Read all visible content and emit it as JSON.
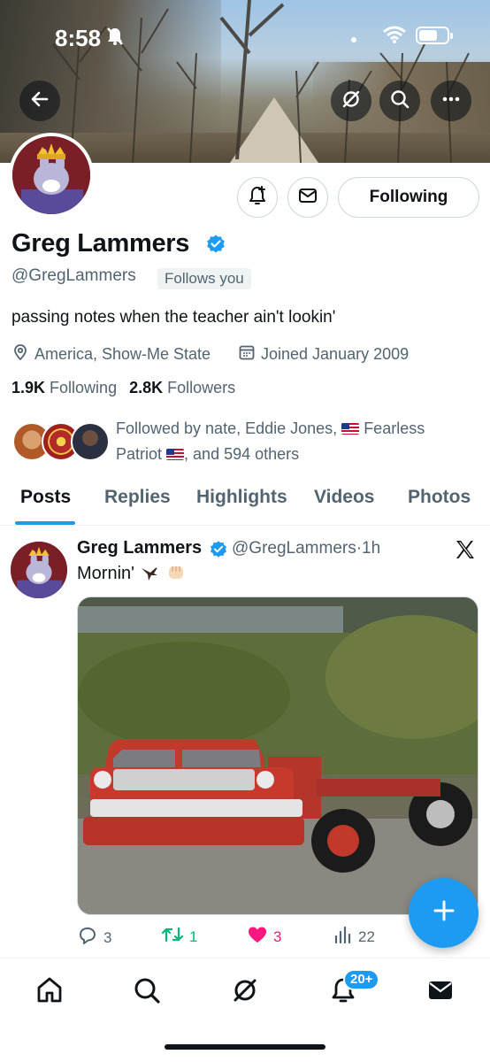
{
  "status_bar": {
    "time": "8:58"
  },
  "profile": {
    "display_name": "Greg Lammers",
    "handle": "@GregLammers",
    "follows_you_label": "Follows you",
    "following_button_label": "Following",
    "bio": "passing notes when the teacher ain't lookin'",
    "location": "America, Show-Me State",
    "joined": "Joined January 2009",
    "following_count": "1.9K",
    "following_label": "Following",
    "followers_count": "2.8K",
    "followers_label": "Followers",
    "followed_by": {
      "prefix": "Followed by nate, Eddie Jones,",
      "name3_first": "Fearless",
      "name3_second": "Patriot",
      "suffix": ", and 594 others"
    }
  },
  "tabs": [
    "Posts",
    "Replies",
    "Highlights",
    "Videos",
    "Photos"
  ],
  "tweet": {
    "author": "Greg Lammers",
    "handle": "@GregLammers",
    "separator": "·",
    "time": "1h",
    "text": "Mornin'",
    "replies": "3",
    "reposts": "1",
    "likes": "3",
    "views": "22"
  },
  "bottom_nav": {
    "items": [
      "home-icon",
      "search-icon",
      "grok-icon",
      "notifications-icon",
      "messages-icon"
    ],
    "notifications_badge": "20+"
  },
  "colors": {
    "accent": "#1d9bf0",
    "text_primary": "#0f1419",
    "text_secondary": "#536471",
    "repost_green": "#00ba7c",
    "like_pink": "#f91880"
  }
}
